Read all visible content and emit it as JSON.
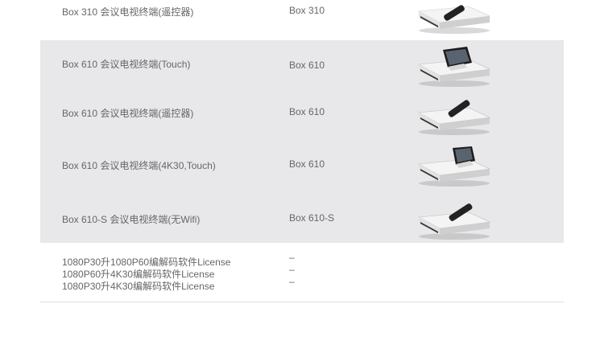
{
  "rows": [
    {
      "name": "Box 310 会议电视终端(遥控器)",
      "model": "Box 310",
      "device_icon": "terminal-with-remote-icon"
    },
    {
      "name": "Box 610 会议电视终端(Touch)",
      "model": "Box 610",
      "device_icon": "terminal-with-touch-panel-icon"
    },
    {
      "name": "Box 610 会议电视终端(遥控器)",
      "model": "Box 610",
      "device_icon": "terminal-with-remote-icon"
    },
    {
      "name": "Box 610 会议电视终端(4K30,Touch)",
      "model": "Box 610",
      "device_icon": "terminal-with-touch-panel-icon"
    },
    {
      "name": "Box 610-S 会议电视终端(无Wifi)",
      "model": "Box 610-S",
      "device_icon": "terminal-with-remote-icon"
    }
  ],
  "licenses": [
    {
      "name": "1080P30升1080P60编解码软件License",
      "model": "–"
    },
    {
      "name": "1080P60升4K30编解码软件License",
      "model": "–"
    },
    {
      "name": "1080P30升4K30编解码软件License",
      "model": "–"
    }
  ],
  "colors": {
    "band": "#e8e8ea",
    "text": "#666666",
    "divider": "#dcdcdc"
  }
}
